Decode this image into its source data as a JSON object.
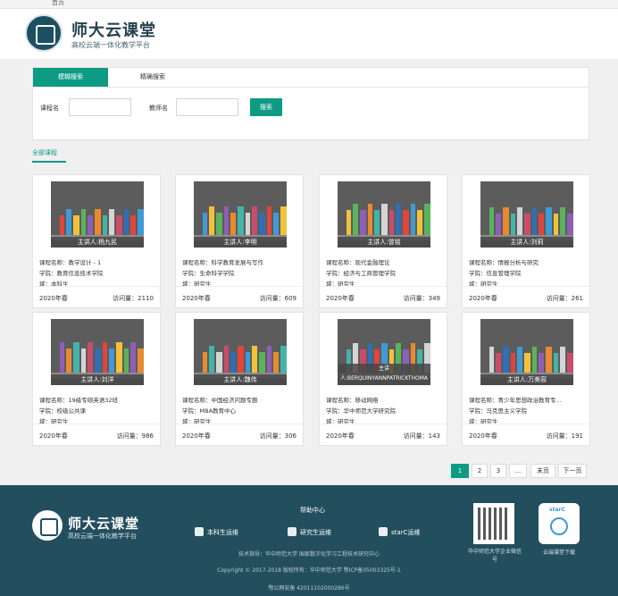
{
  "topbar": {
    "home": "首页"
  },
  "header": {
    "title": "师大云课堂",
    "subtitle": "高校云端一体化教学平台"
  },
  "search": {
    "tab_fuzzy": "模糊搜索",
    "tab_exact": "精确搜索",
    "course_label": "课程名",
    "teacher_label": "教师名",
    "course_value": "",
    "teacher_value": "",
    "button": "搜索"
  },
  "section_tab": "全部课程",
  "courses": [
    {
      "teacher": "主讲人:杨九民",
      "name": "课程名称：教学设计 - 1",
      "college": "学院：教育信息技术学院",
      "level": "域：本科生",
      "term": "2020年春",
      "visits": "访问量：2110"
    },
    {
      "teacher": "主讲人:李明",
      "name": "课程名称：科学教育发展与写作",
      "college": "学院：生命科学学院",
      "level": "域：研究生",
      "term": "2020年春",
      "visits": "访问量：609"
    },
    {
      "teacher": "主讲人:曾铭",
      "name": "课程名称：现代金融理论",
      "college": "学院：经济与工商管理学院",
      "level": "域：研究生",
      "term": "2020年春",
      "visits": "访问量：349"
    },
    {
      "teacher": "主讲人:刘莉",
      "name": "课程名称：情报分析与研究",
      "college": "学院：信息管理学院",
      "level": "域：研究生",
      "term": "2020年春",
      "visits": "访问量：261"
    },
    {
      "teacher": "主讲人:刘洋",
      "name": "课程名称：19级专硕英语32班",
      "college": "学院：校级公共课",
      "level": "域：研究生",
      "term": "2020年春",
      "visits": "访问量：986"
    },
    {
      "teacher": "主讲人:魏伟",
      "name": "课程名称：中国经济问题专题",
      "college": "学院：MBA教育中心",
      "level": "域：研究生",
      "term": "2020年春",
      "visits": "访问量：306"
    },
    {
      "teacher": "主讲人:BERQUINYANNPATRICKTHOMA",
      "name": "课程名称：移动网络",
      "college": "学院：华中师范大学研究院",
      "level": "域：研究生",
      "term": "2020年春",
      "visits": "访问量：143"
    },
    {
      "teacher": "主讲人:万美容",
      "name": "课程名称：青少年思想政治教育专...",
      "college": "学院：马克思主义学院",
      "level": "域：研究生",
      "term": "2020年春",
      "visits": "访问量：191"
    }
  ],
  "pagination": {
    "p1": "1",
    "p2": "2",
    "p3": "3",
    "ellipsis": "...",
    "last": "末页",
    "next": "下一页"
  },
  "footer": {
    "title": "师大云课堂",
    "subtitle": "高校云端一体化教学平台",
    "help_title": "帮助中心",
    "links": [
      "本科生运维",
      "研究生运维",
      "starC运维"
    ],
    "tech": "技术指导：华中师范大学 国家数字化学习工程技术研究中心",
    "copyright": "Copyright © 2017-2018 版权所有：华中师范大学 鄂ICP备05003325号-1",
    "police": "鄂公网安备 42011102000286号",
    "qr_caption": "华中师范大学企业微信号",
    "app_caption": "云端课堂下载",
    "app_brand": "starC"
  },
  "colors": {
    "accent": "#0e9b84",
    "footer": "#234e5e"
  }
}
